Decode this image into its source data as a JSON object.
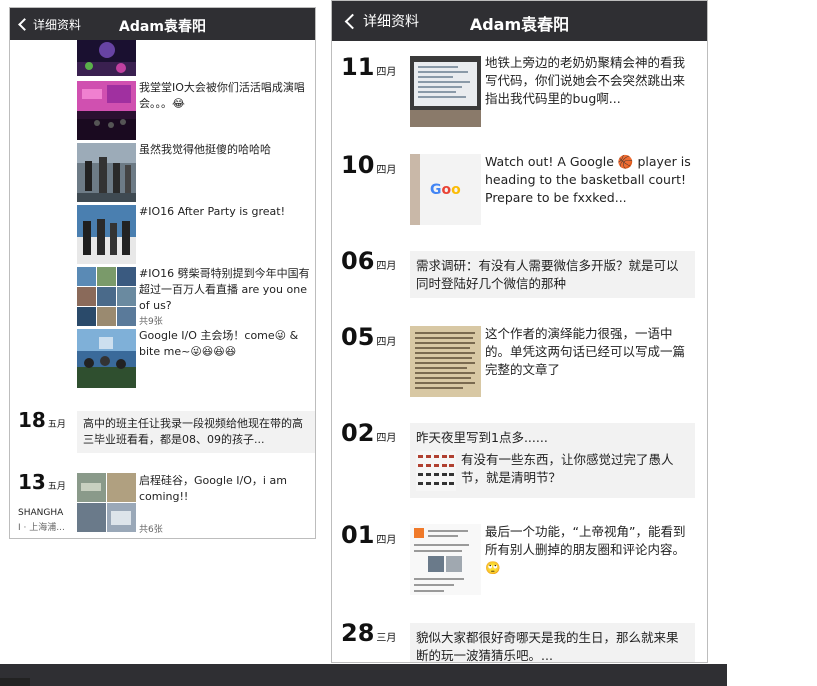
{
  "left_phone": {
    "nav": {
      "back_label": "详细资料",
      "title": "Adam袁春阳"
    },
    "items": [
      {
        "text": "我堂堂IO大会被你们活活唱成演唱会。。。😂"
      },
      {
        "text": "虽然我觉得他挺傻的哈哈哈"
      },
      {
        "text": "#IO16 After Party is great!"
      },
      {
        "text": "#IO16 劈柴哥特别提到今年中国有超过一百万人看直播 are you one of us?",
        "count": "共9张"
      },
      {
        "text": "Google I/O 主会场！come😜 & bite me~😜😆😆😆"
      }
    ],
    "day18": {
      "day": "18",
      "month": "五月",
      "text": "高中的班主任让我录一段视频给他现在带的高三毕业班看看，都是08、09的孩子..."
    },
    "day13": {
      "day": "13",
      "month": "五月",
      "location_line1": "SHANGHA",
      "location_line2": "I · 上海浦...",
      "text": "启程硅谷，Google I/O，i am coming!!",
      "count": "共6张"
    }
  },
  "right_phone": {
    "nav": {
      "back_label": "详细资料",
      "title": "Adam袁春阳"
    },
    "posts": [
      {
        "day": "11",
        "month": "四月",
        "text": "地铁上旁边的老奶奶聚精会神的看我写代码，你们说她会不会突然跳出来指出我代码里的bug啊..."
      },
      {
        "day": "10",
        "month": "四月",
        "text": "Watch out! A Google 🏀 player is heading to the basketball court! Prepare to be fxxked..."
      },
      {
        "day": "06",
        "month": "四月",
        "text": "需求调研：有没有人需要微信多开版？就是可以同时登陆好几个微信的那种"
      },
      {
        "day": "05",
        "month": "四月",
        "text": "这个作者的演绎能力很强，一语中的。单凭这两句话已经可以写成一篇完整的文章了"
      },
      {
        "day": "02",
        "month": "四月",
        "text": "昨天夜里写到1点多......",
        "sub_text": "有没有一些东西，让你感觉过完了愚人节，就是清明节？"
      },
      {
        "day": "01",
        "month": "四月",
        "text": "最后一个功能，“上帝视角”，能看到所有别人删掉的朋友圈和评论内容。🙄"
      },
      {
        "day": "28",
        "month": "三月",
        "text": "貌似大家都很好奇哪天是我的生日，那么就来果断的玩一波猜猜乐吧。..."
      }
    ]
  },
  "colors": {
    "navbar": "#2f2f33",
    "bubble": "#f2f2f2",
    "text": "#222222"
  }
}
